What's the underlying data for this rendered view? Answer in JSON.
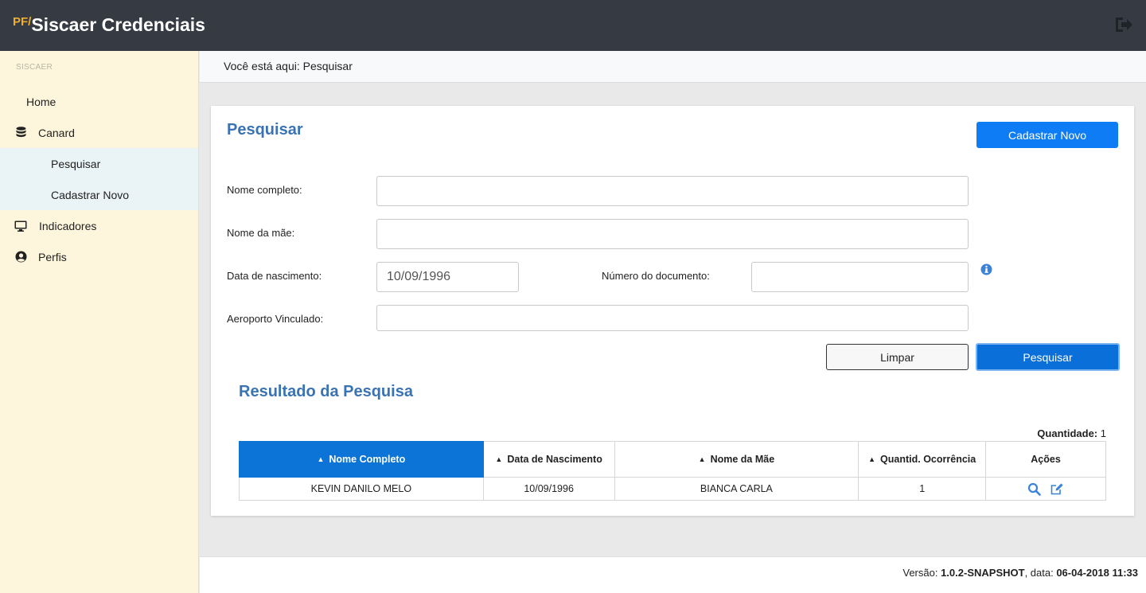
{
  "header": {
    "brand_prefix": "PF/",
    "brand_name": "Siscaer Credenciais",
    "logout_icon": "sign-out-icon"
  },
  "sidebar": {
    "section": "SISCAER",
    "items": [
      {
        "label": "Home",
        "icon": ""
      },
      {
        "label": "Canard",
        "icon": "database-icon"
      },
      {
        "label": "Pesquisar",
        "icon": ""
      },
      {
        "label": "Cadastrar Novo",
        "icon": ""
      },
      {
        "label": "Indicadores",
        "icon": "monitor-icon"
      },
      {
        "label": "Perfis",
        "icon": "user-circle-icon"
      }
    ]
  },
  "breadcrumb": "Você está aqui: Pesquisar",
  "search": {
    "title": "Pesquisar",
    "new_button": "Cadastrar Novo",
    "fields": {
      "nome_label": "Nome completo:",
      "nome_value": "",
      "mae_label": "Nome da mãe:",
      "mae_value": "",
      "nascimento_label": "Data de nascimento:",
      "nascimento_value": "10/09/1996",
      "documento_label": "Número do documento:",
      "documento_value": "",
      "aeroporto_label": "Aeroporto Vinculado:",
      "aeroporto_value": ""
    },
    "clear_button": "Limpar",
    "search_button": "Pesquisar"
  },
  "results": {
    "title": "Resultado da Pesquisa",
    "quantity_label": "Quantidade:",
    "quantity_value": "1",
    "columns": [
      "Nome Completo",
      "Data de Nascimento",
      "Nome da Mãe",
      "Quantid. Ocorrência",
      "Ações"
    ],
    "rows": [
      {
        "nome": "KEVIN DANILO MELO",
        "nascimento": "10/09/1996",
        "mae": "BIANCA CARLA",
        "ocorrencias": "1"
      }
    ]
  },
  "footer": {
    "version_label": "Versão:",
    "version": "1.0.2-SNAPSHOT",
    "date_label": ", data:",
    "date": "06-04-2018",
    "time": "11:33"
  },
  "colors": {
    "topbar": "#363a42",
    "sidebar": "#fef6dc",
    "accent": "#0d7cf5",
    "title": "#3a73b4",
    "brand_prefix": "#f0ad2e"
  }
}
